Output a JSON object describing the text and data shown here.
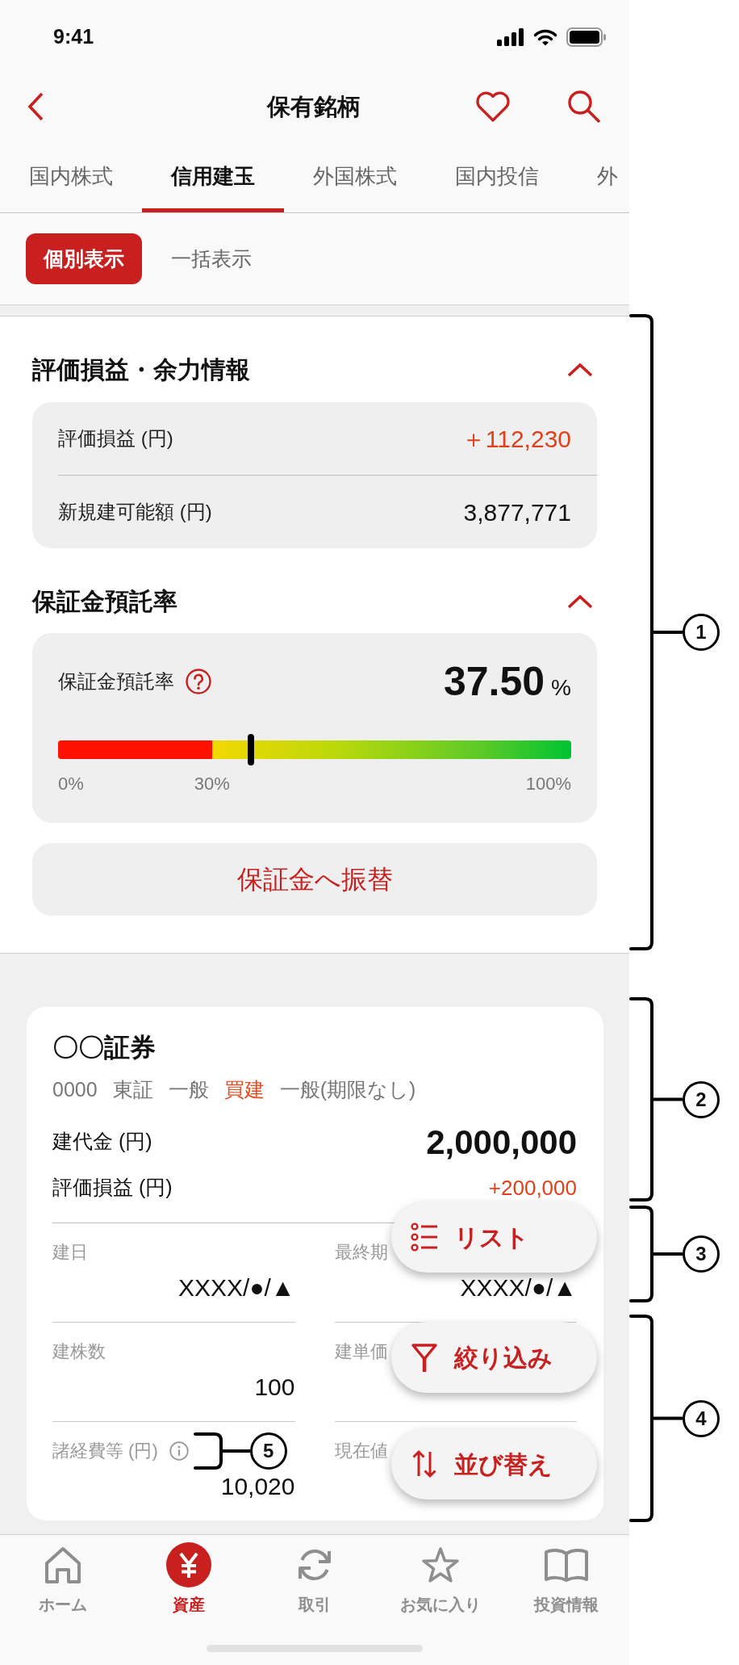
{
  "status_bar": {
    "time": "9:41"
  },
  "header": {
    "title": "保有銘柄"
  },
  "tabs": [
    {
      "label": "国内株式",
      "selected": false
    },
    {
      "label": "信用建玉",
      "selected": true
    },
    {
      "label": "外国株式",
      "selected": false
    },
    {
      "label": "国内投信",
      "selected": false
    },
    {
      "label": "外",
      "selected": false
    }
  ],
  "view_toggle": [
    {
      "label": "個別表示",
      "selected": true
    },
    {
      "label": "一括表示",
      "selected": false
    }
  ],
  "summary": {
    "title": "評価損益・余力情報",
    "expanded": true,
    "rows": [
      {
        "label": "評価損益 (円)",
        "value": "＋112,230",
        "kind": "gain"
      },
      {
        "label": "新規建可能額 (円)",
        "value": "3,877,771",
        "kind": "amount"
      }
    ]
  },
  "margin_rate": {
    "title": "保証金預託率",
    "expanded": true,
    "label": "保証金預託率",
    "value": "37.50",
    "unit": "%",
    "danger_zone": {
      "level": 0.3
    },
    "marker": {
      "level": 0.375
    },
    "ticks": [
      "0%",
      "30%",
      "100%"
    ],
    "button": "保証金へ振替"
  },
  "position": {
    "title": "〇〇証券",
    "tags": [
      {
        "text": "0000",
        "kind": "plain"
      },
      {
        "text": "東証",
        "kind": "plain"
      },
      {
        "text": "一般",
        "kind": "plain"
      },
      {
        "text": "買建",
        "kind": "side"
      },
      {
        "text": "一般(期限なし)",
        "kind": "plain"
      }
    ],
    "amount": {
      "label": "建代金 (円)",
      "value": "2,000,000"
    },
    "pnl": {
      "label": "評価損益 (円)",
      "value": "+200,000"
    },
    "fields": [
      {
        "label": "建日",
        "value": "XXXX/●/▲",
        "info": false
      },
      {
        "label": "最終期",
        "value": "XXXX/●/▲",
        "info": false
      },
      {
        "label": "建株数",
        "value": "100",
        "info": false
      },
      {
        "label": "建単価",
        "info": false
      },
      {
        "label": "諸経費等 (円)",
        "value": "10,020",
        "info": true
      },
      {
        "label": "現在値",
        "info": false
      }
    ]
  },
  "actions": [
    {
      "label": "リスト",
      "kind": "list"
    },
    {
      "label": "絞り込み",
      "kind": "filter"
    },
    {
      "label": "並び替え",
      "kind": "sort"
    }
  ],
  "bottom_nav": [
    {
      "label": "ホーム",
      "kind": "home",
      "selected": false
    },
    {
      "label": "資産",
      "kind": "assets",
      "selected": true
    },
    {
      "label": "取引",
      "kind": "trade",
      "selected": false
    },
    {
      "label": "お気に入り",
      "kind": "favorites",
      "selected": false
    },
    {
      "label": "投資情報",
      "kind": "info",
      "selected": false
    }
  ],
  "callouts": [
    {
      "label": "1",
      "kind": "bracket"
    },
    {
      "label": "2",
      "kind": "bracket"
    },
    {
      "label": "3",
      "kind": "bracket"
    },
    {
      "label": "4",
      "kind": "bracket"
    },
    {
      "label": "5",
      "kind": "pointer"
    }
  ]
}
